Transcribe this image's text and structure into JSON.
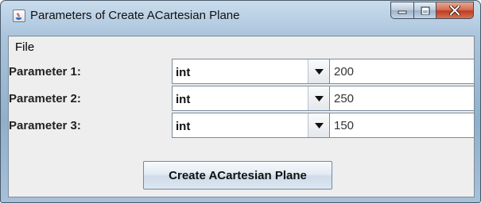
{
  "window": {
    "title": "Parameters of Create  ACartesian Plane",
    "icon": "java-app-icon",
    "controls": [
      "minimize-icon",
      "maximize-icon",
      "close-icon"
    ]
  },
  "menubar": {
    "items": [
      {
        "label": "File"
      }
    ]
  },
  "params": [
    {
      "label": "Parameter 1:",
      "type": "int",
      "value": "200"
    },
    {
      "label": "Parameter 2:",
      "type": "int",
      "value": "250"
    },
    {
      "label": "Parameter 3:",
      "type": "int",
      "value": "150"
    }
  ],
  "actions": {
    "create_label": "Create  ACartesian Plane"
  },
  "colors": {
    "titlebar": "#a6c1da",
    "close_button": "#c8492c",
    "client_bg": "#eeeeee"
  }
}
